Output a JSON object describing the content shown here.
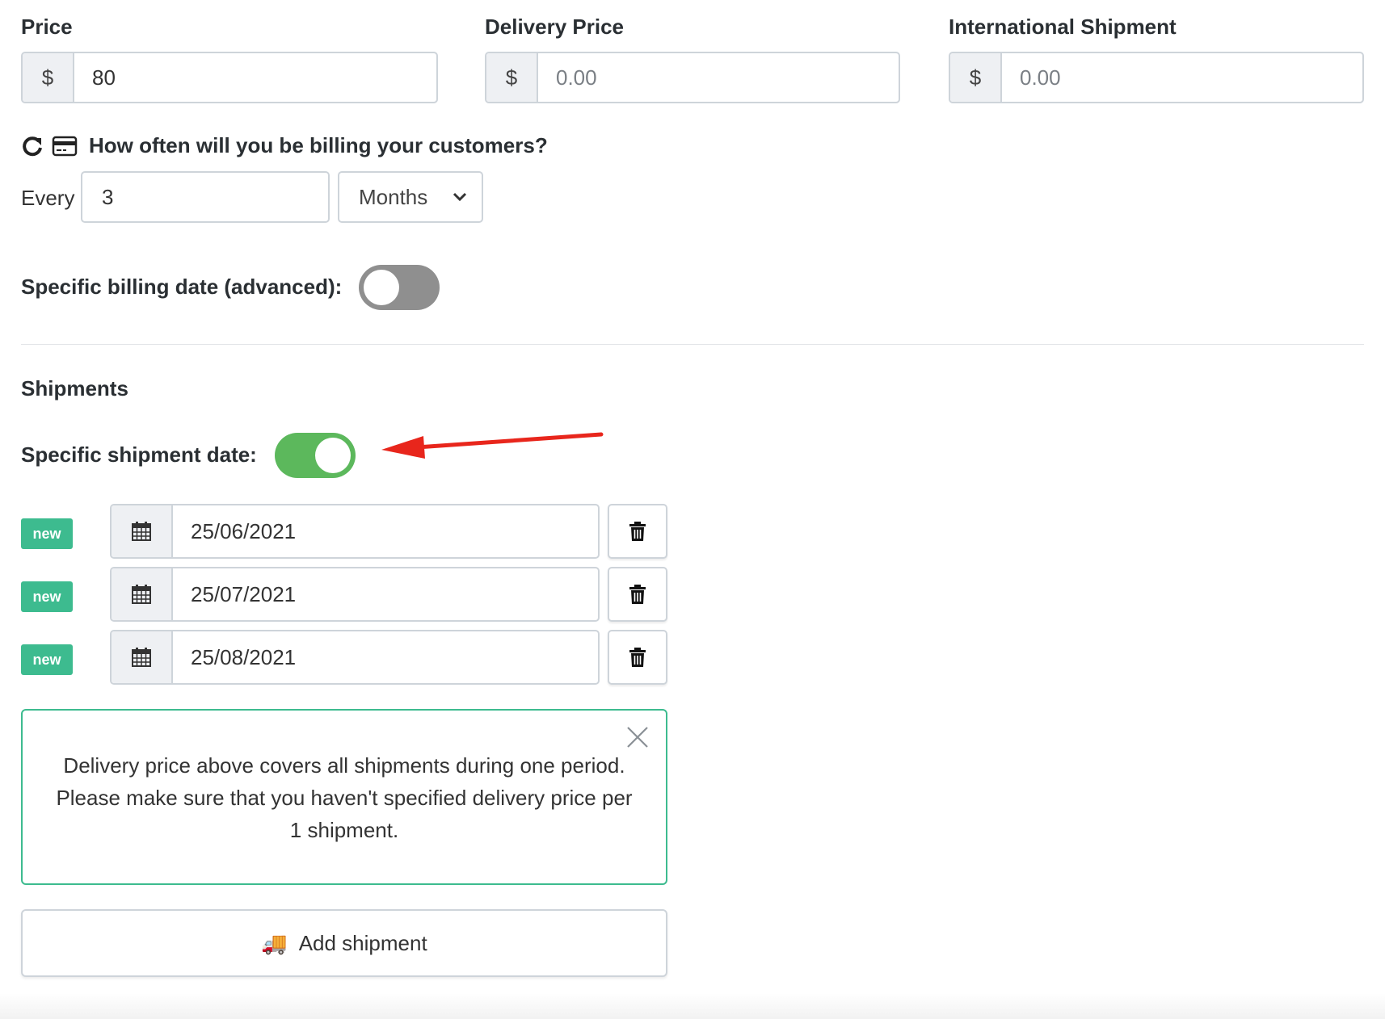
{
  "pricing": {
    "price_label": "Price",
    "price_currency": "$",
    "price_value": "80",
    "delivery_label": "Delivery Price",
    "delivery_currency": "$",
    "delivery_placeholder": "0.00",
    "international_label": "International Shipment",
    "international_currency": "$",
    "international_placeholder": "0.00"
  },
  "billing": {
    "question": "How often will you be billing your customers?",
    "every_label": "Every",
    "every_value": "3",
    "period_selected": "Months",
    "specific_date_label": "Specific billing date (advanced):",
    "specific_date_enabled": false
  },
  "shipments": {
    "section_title": "Shipments",
    "specific_date_label": "Specific shipment date:",
    "specific_date_enabled": true,
    "rows": [
      {
        "badge": "new",
        "date": "25/06/2021"
      },
      {
        "badge": "new",
        "date": "25/07/2021"
      },
      {
        "badge": "new",
        "date": "25/08/2021"
      }
    ],
    "notice_text": "Delivery price above covers all shipments during one period. Please make sure that you haven't specified delivery price per 1 shipment.",
    "add_button_label": "Add shipment",
    "add_button_icon": "🚚"
  },
  "colors": {
    "accent_green": "#3dbb8f",
    "toggle_on": "#5cb85c",
    "toggle_off": "#8f8f8f",
    "arrow_red": "#e8261c"
  }
}
